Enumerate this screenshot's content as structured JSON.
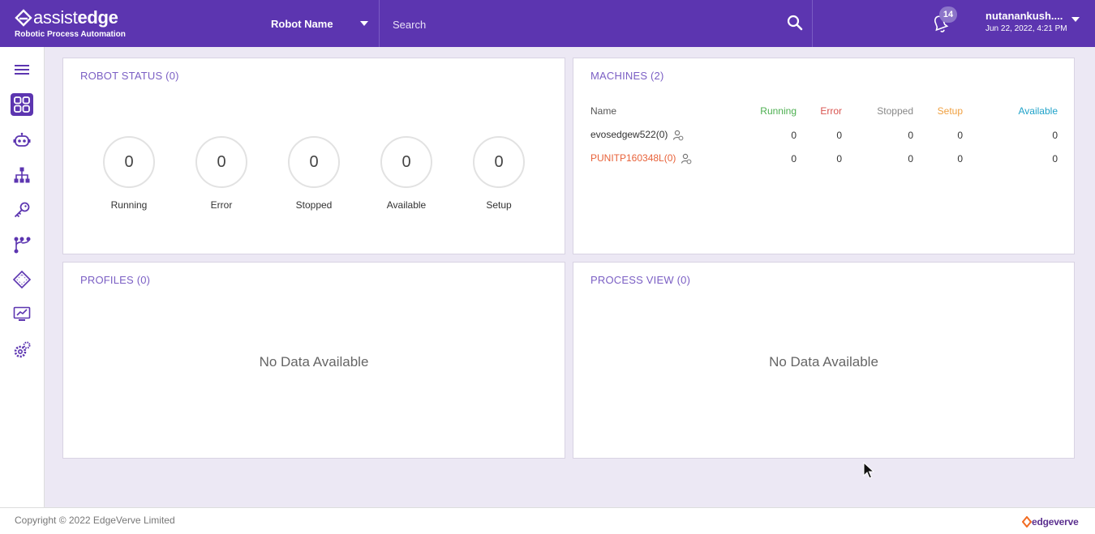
{
  "header": {
    "logo_text_light": "assist",
    "logo_text_bold": "edge",
    "logo_subtitle": "Robotic Process Automation",
    "robot_select_label": "Robot Name",
    "search_placeholder": "Search",
    "notification_count": "14",
    "user_name": "nutanankush....",
    "user_datetime": "Jun 22, 2022, 4:21 PM",
    "brand_color": "#5c35b0"
  },
  "sidebar": {
    "items": [
      {
        "icon": "hamburger-menu-icon"
      },
      {
        "icon": "dashboard-grid-icon",
        "active": true
      },
      {
        "icon": "robot-icon"
      },
      {
        "icon": "hierarchy-icon"
      },
      {
        "icon": "key-icon"
      },
      {
        "icon": "process-flow-icon"
      },
      {
        "icon": "chip-icon"
      },
      {
        "icon": "monitor-chart-icon"
      },
      {
        "icon": "settings-gears-icon"
      }
    ]
  },
  "robot_status": {
    "title": "ROBOT STATUS (0)",
    "items": [
      {
        "label": "Running",
        "value": "0"
      },
      {
        "label": "Error",
        "value": "0"
      },
      {
        "label": "Stopped",
        "value": "0"
      },
      {
        "label": "Available",
        "value": "0"
      },
      {
        "label": "Setup",
        "value": "0"
      }
    ]
  },
  "machines": {
    "title": "MACHINES (2)",
    "headers": {
      "name": "Name",
      "running": "Running",
      "error": "Error",
      "stopped": "Stopped",
      "setup": "Setup",
      "available": "Available"
    },
    "header_colors": {
      "running": "#4caf50",
      "error": "#d9534f",
      "stopped": "#888888",
      "setup": "#f0a040",
      "available": "#1fa2c9"
    },
    "rows": [
      {
        "name": "evosedgew522(0)",
        "running": "0",
        "error": "0",
        "stopped": "0",
        "setup": "0",
        "available": "0",
        "name_color": "#333333"
      },
      {
        "name": "PUNITP160348L(0)",
        "running": "0",
        "error": "0",
        "stopped": "0",
        "setup": "0",
        "available": "0",
        "name_color": "#e8623a"
      }
    ]
  },
  "profiles": {
    "title": "PROFILES (0)",
    "empty_text": "No Data Available"
  },
  "process_view": {
    "title": "PROCESS VIEW (0)",
    "empty_text": "No Data Available"
  },
  "footer": {
    "copyright": "Copyright © 2022 EdgeVerve Limited",
    "brand_logo_text": "edgeverve"
  }
}
